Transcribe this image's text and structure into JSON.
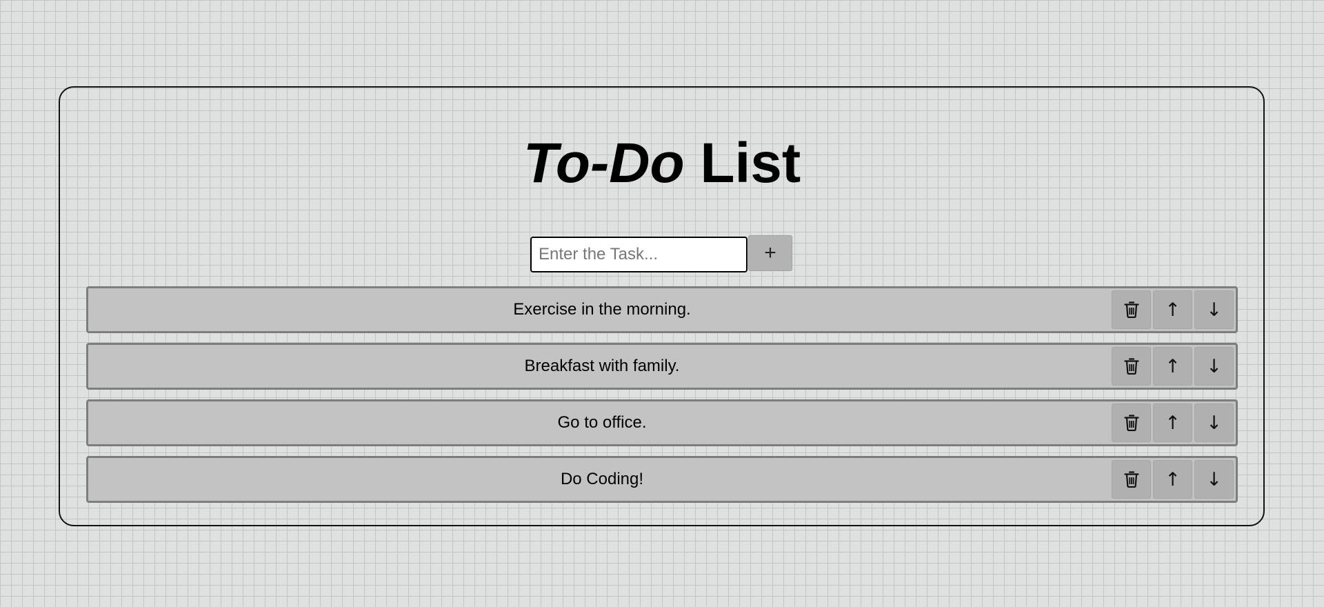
{
  "header": {
    "title_italic": "To-Do",
    "title_rest": " List"
  },
  "task_input": {
    "value": "",
    "placeholder": "Enter the Task..."
  },
  "add_button": {
    "label": "+",
    "icon": "plus-icon"
  },
  "tasks": [
    {
      "text": "Exercise in the morning."
    },
    {
      "text": "Breakfast with family."
    },
    {
      "text": "Go to office."
    },
    {
      "text": "Do Coding!"
    }
  ],
  "task_actions": {
    "delete_icon": "trash-icon",
    "move_up_glyph": "↑",
    "move_down_glyph": "↓"
  },
  "colors": {
    "page_background": "#dcdddd",
    "grid_line": "#9ea1a3",
    "task_background": "#c3c3c3",
    "task_border": "#7d7d7d",
    "button_background": "#b0b0b0",
    "container_border": "#111111"
  }
}
